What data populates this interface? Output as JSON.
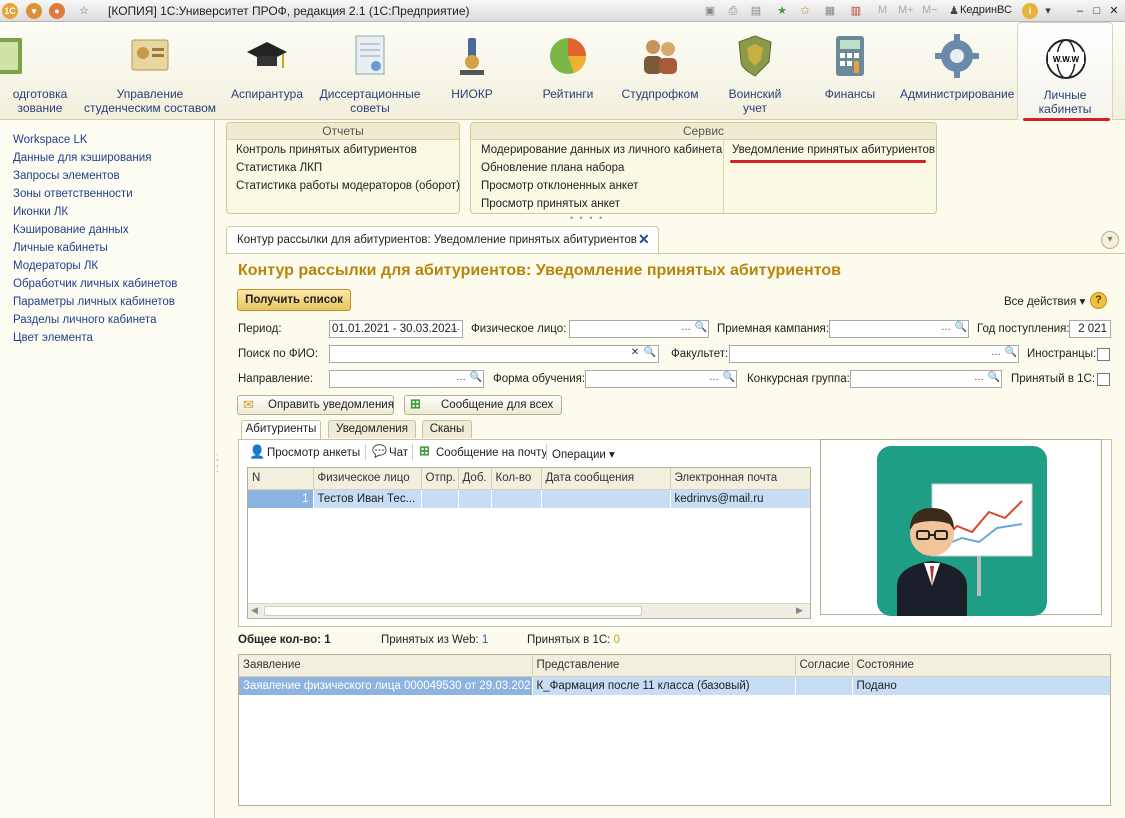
{
  "window": {
    "title": "[КОПИЯ] 1С:Университет ПРОФ, редакция 2.1  (1С:Предприятие)",
    "mem_buttons": [
      "M",
      "M+",
      "M−"
    ],
    "user": "КедринВС"
  },
  "sections": [
    {
      "label": "одготовка\nзование"
    },
    {
      "label": "Управление\nстуденческим составом"
    },
    {
      "label": "Аспирантура"
    },
    {
      "label": "Диссертационные\nсоветы"
    },
    {
      "label": "НИОКР"
    },
    {
      "label": "Рейтинги"
    },
    {
      "label": "Студпрофком"
    },
    {
      "label": "Воинский\nучет"
    },
    {
      "label": "Финансы"
    },
    {
      "label": "Администрирование"
    },
    {
      "label": "Личные\nкабинеты"
    }
  ],
  "leftnav": [
    "Workspace LK",
    "Данные для кэширования",
    "Запросы элементов",
    "Зоны ответственности",
    "Иконки ЛК",
    "Кэширование данных",
    "Личные кабинеты",
    "Модераторы ЛК",
    "Обработчик личных кабинетов",
    "Параметры личных кабинетов",
    "Разделы личного кабинета",
    "Цвет элемента"
  ],
  "reports": {
    "title": "Отчеты",
    "items": [
      "Контроль принятых абитуриентов",
      "Статистика ЛКП",
      "Статистика работы модераторов (оборот)"
    ]
  },
  "service": {
    "title": "Сервис",
    "items_left": [
      "Модерирование данных из личного кабинета",
      "Обновление плана набора",
      "Просмотр отклоненных анкет",
      "Просмотр принятых анкет"
    ],
    "items_right": [
      "Уведомление принятых абитуриентов"
    ]
  },
  "doc_tab": {
    "label": "Контур рассылки для абитуриентов: Уведомление принятых абитуриентов"
  },
  "form": {
    "title": "Контур рассылки для абитуриентов: Уведомление принятых абитуриентов",
    "get_list": "Получить список",
    "all_actions": "Все действия",
    "help": "?",
    "period_label": "Период:",
    "period_value": "01.01.2021 - 30.03.2021",
    "person_label": "Физическое лицо:",
    "person_value": "",
    "campaign_label": "Приемная кампания:",
    "campaign_value": "",
    "year_label": "Год поступления:",
    "year_value": "2 021",
    "fio_label": "Поиск по ФИО:",
    "fio_value": "",
    "faculty_label": "Факультет:",
    "faculty_value": "",
    "foreign_label": "Иностранцы:",
    "direction_label": "Направление:",
    "direction_value": "",
    "study_form_label": "Форма обучения:",
    "study_form_value": "",
    "group_label": "Конкурсная группа:",
    "group_value": "",
    "accepted_label": "Принятый в 1С:",
    "send_btn": "Оправить уведомления",
    "msg_all_btn": "Сообщение для всех"
  },
  "inner_tabs": [
    "Абитуриенты",
    "Уведомления",
    "Сканы"
  ],
  "toolbar": {
    "view": "Просмотр анкеты",
    "chat": "Чат",
    "mail": "Сообщение на почту",
    "ops": "Операции"
  },
  "grid1": {
    "columns": [
      "N",
      "Физическое лицо",
      "Отпр.",
      "Доб.",
      "Кол-во",
      "Дата сообщения",
      "Электронная почта"
    ],
    "rows": [
      [
        "1",
        "Тестов Иван Тес...",
        "",
        "",
        "",
        "",
        "kedrinvs@mail.ru"
      ]
    ]
  },
  "totals": {
    "total_label": "Общее кол-во:",
    "total_value": "1",
    "web_label": "Принятых из Web:",
    "web_value": "1",
    "c1_label": "Принятых в 1С:",
    "c1_value": "0"
  },
  "grid2": {
    "columns": [
      "Заявление",
      "Представление",
      "Согласие",
      "Состояние"
    ],
    "rows": [
      [
        "Заявление физического лица 000049530 от 29.03.202...",
        "К_Фармация после 11 класса (базовый)",
        "",
        "Подано"
      ]
    ]
  },
  "colors": {
    "accent": "#b5850c",
    "link": "#243f8a",
    "selection": "#c7ddf5",
    "underline": "#d42020"
  }
}
